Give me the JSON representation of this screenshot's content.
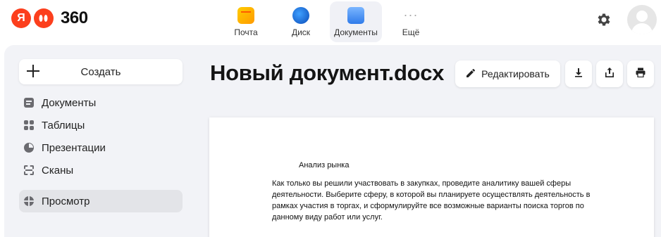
{
  "brand": {
    "logo_letter": "Я",
    "logo_text": "360"
  },
  "apps": [
    {
      "label": "Почта",
      "icon": "mail-icon"
    },
    {
      "label": "Диск",
      "icon": "disk-icon"
    },
    {
      "label": "Документы",
      "icon": "documents-icon",
      "active": true
    },
    {
      "label": "Ещё",
      "icon": "more-icon"
    }
  ],
  "more_glyph": "···",
  "settings_icon": "gear-icon",
  "sidebar": {
    "create_label": "Создать",
    "items": [
      {
        "label": "Документы",
        "icon": "documents-icon"
      },
      {
        "label": "Таблицы",
        "icon": "tables-icon"
      },
      {
        "label": "Презентации",
        "icon": "presentation-icon"
      },
      {
        "label": "Сканы",
        "icon": "scan-icon"
      },
      {
        "label": "Просмотр",
        "icon": "globe-icon",
        "active": true
      }
    ]
  },
  "document": {
    "title": "Новый документ.docx",
    "edit_label": "Редактировать",
    "actions": [
      "download-icon",
      "share-icon",
      "print-icon"
    ],
    "heading": "Анализ рынка",
    "body_lines": [
      "Как только вы решили участвовать в закупках, проведите аналитику вашей сферы",
      "деятельности. Выберите сферу, в которой вы планируете осуществлять деятельность в",
      "рамках участия в торгах, и сформулируйте все возможные варианты поиска торгов по",
      "данному виду работ или услуг."
    ]
  },
  "colors": {
    "accent": "#fc3f1d",
    "sidebar_bg": "#f2f3f7",
    "active_item": "#e3e4e8"
  }
}
